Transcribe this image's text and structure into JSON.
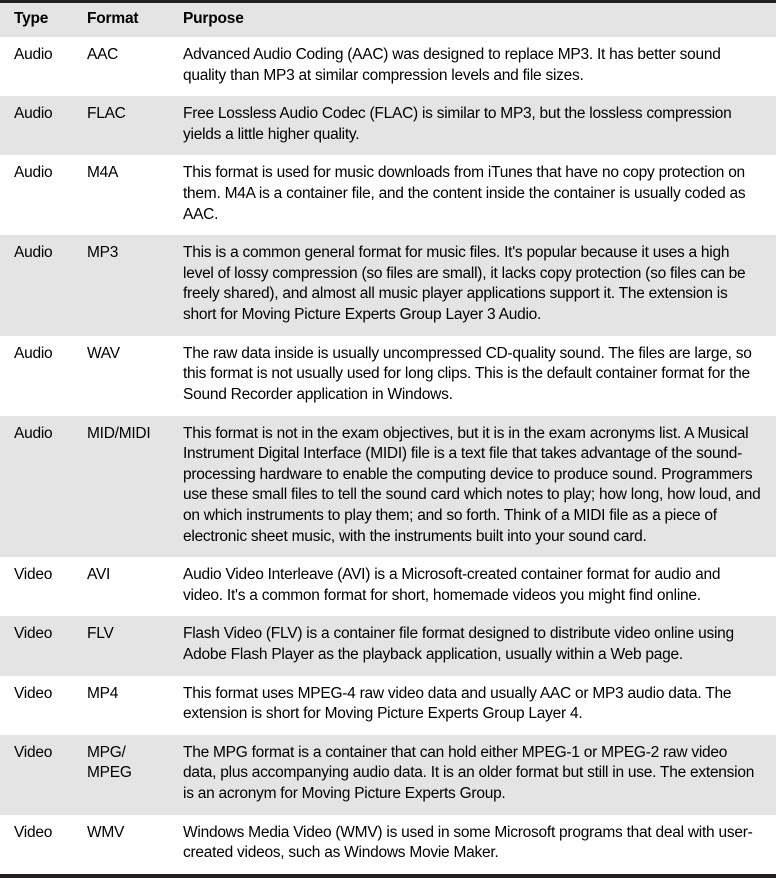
{
  "table": {
    "columns": [
      {
        "key": "type",
        "label": "Type"
      },
      {
        "key": "format",
        "label": "Format"
      },
      {
        "key": "purpose",
        "label": "Purpose"
      }
    ],
    "header_background": "#e4e4e4",
    "row_shade_color": "#e4e4e4",
    "border_color": "#231f20",
    "rows": [
      {
        "type": "Audio",
        "format": "AAC",
        "format_line2": "",
        "purpose": "Advanced Audio Coding (AAC) was designed to replace MP3. It has better sound quality than MP3 at similar compression levels and file sizes."
      },
      {
        "type": "Audio",
        "format": "FLAC",
        "format_line2": "",
        "purpose": "Free Lossless Audio Codec (FLAC) is similar to MP3, but the lossless compression yields a little higher quality."
      },
      {
        "type": "Audio",
        "format": "M4A",
        "format_line2": "",
        "purpose": "This format is used for music downloads from iTunes that have no copy protection on them. M4A is a container file, and the content inside the container is usually coded as AAC."
      },
      {
        "type": "Audio",
        "format": "MP3",
        "format_line2": "",
        "purpose": "This is a common general format for music files. It's popular because it uses a high level of lossy compression (so files are small), it lacks copy protection (so files can be freely shared), and almost all music player applications support it. The extension is short for Moving Picture Experts Group Layer 3 Audio."
      },
      {
        "type": "Audio",
        "format": "WAV",
        "format_line2": "",
        "purpose": "The raw data inside is usually uncompressed CD-quality sound. The files are large, so this format is not usually used for long clips. This is the default container format for the Sound Recorder application in Windows."
      },
      {
        "type": "Audio",
        "format": "MID/MIDI",
        "format_line2": "",
        "purpose": "This format is not in the exam objectives, but it is in the exam acronyms list. A Musical Instrument Digital Interface (MIDI) file is a text file that takes advantage of the sound-processing hardware to enable the computing device to produce sound. Programmers use these small files to tell the sound card which notes to play; how long, how loud, and on which instruments to play them; and so forth. Think of a MIDI file as a piece of electronic sheet music, with the instruments built into your sound card."
      },
      {
        "type": "Video",
        "format": "AVI",
        "format_line2": "",
        "purpose": "Audio Video Interleave (AVI) is a Microsoft-created container format for audio and video. It's a common format for short, homemade videos you might find online."
      },
      {
        "type": "Video",
        "format": "FLV",
        "format_line2": "",
        "purpose": "Flash Video (FLV) is a container file format designed to distribute video online using Adobe Flash Player as the playback application, usually within a Web page."
      },
      {
        "type": "Video",
        "format": "MP4",
        "format_line2": "",
        "purpose": "This format uses MPEG-4 raw video data and usually AAC or MP3 audio data. The extension is short for Moving Picture Experts Group Layer 4."
      },
      {
        "type": "Video",
        "format": "MPG/",
        "format_line2": "MPEG",
        "purpose": "The MPG format is a container that can hold either MPEG-1 or MPEG-2 raw video data, plus accompanying audio data. It is an older format but still in use. The extension is an acronym for Moving Picture Experts Group."
      },
      {
        "type": "Video",
        "format": "WMV",
        "format_line2": "",
        "purpose": "Windows Media Video (WMV) is used in some Microsoft programs that deal with user-created videos, such as Windows Movie Maker."
      }
    ]
  }
}
